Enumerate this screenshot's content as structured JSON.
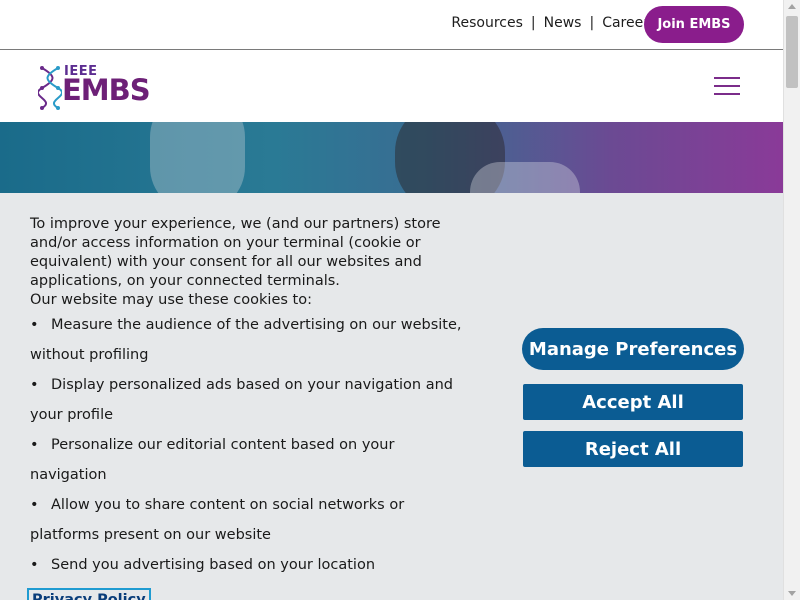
{
  "topbar": {
    "links": [
      "Resources",
      "News",
      "Careers"
    ],
    "separator": "|",
    "join_label": "Join EMBS"
  },
  "header": {
    "logo_top": "IEEE",
    "logo_main": "EMBS",
    "menu_icon": "hamburger-icon"
  },
  "cookie": {
    "intro": "To improve your experience, we (and our partners) store and/or access information on your terminal (cookie or equivalent) with your consent for all our websites and applications, on your connected terminals.",
    "subtitle": "Our website may use these cookies to:",
    "items": [
      "Measure the audience of the advertising on our website, without profiling",
      "Display personalized ads based on your navigation and your profile",
      "Personalize our editorial content based on your navigation",
      "Allow you to share content on social networks or platforms present on our website",
      "Send you advertising based on your location"
    ],
    "bullet": "•",
    "privacy_label": "Privacy Policy",
    "manage_label": "Manage Preferences",
    "accept_label": "Accept All",
    "reject_label": "Reject All"
  },
  "colors": {
    "brand_purple": "#8a1d8c",
    "button_blue": "#0b5c93",
    "panel_bg": "#e6e8ea"
  }
}
